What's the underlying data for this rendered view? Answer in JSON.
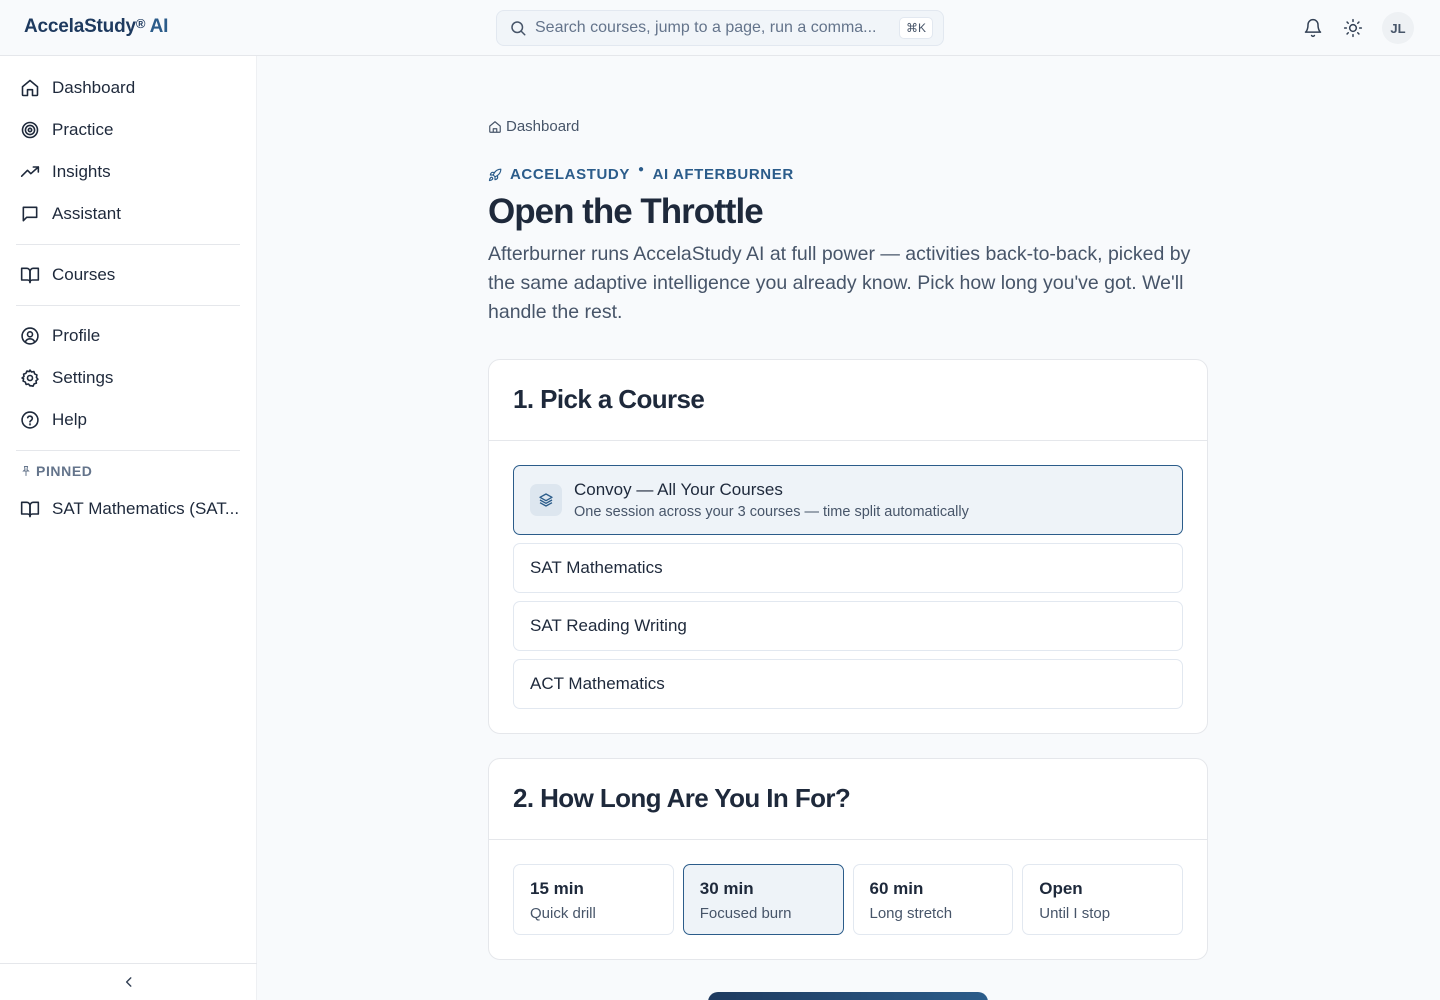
{
  "brand": {
    "name": "AccelaStudy",
    "reg": "®",
    "ai": "AI"
  },
  "search": {
    "placeholder": "Search courses, jump to a page, run a comma...",
    "shortcut": "⌘K"
  },
  "header": {
    "avatar_initials": "JL"
  },
  "sidebar": {
    "items": [
      {
        "label": "Dashboard",
        "icon": "home-icon"
      },
      {
        "label": "Practice",
        "icon": "target-icon"
      },
      {
        "label": "Insights",
        "icon": "trending-up-icon"
      },
      {
        "label": "Assistant",
        "icon": "message-square-icon"
      },
      {
        "label": "Courses",
        "icon": "book-open-icon"
      },
      {
        "label": "Profile",
        "icon": "user-circle-icon"
      },
      {
        "label": "Settings",
        "icon": "gear-icon"
      },
      {
        "label": "Help",
        "icon": "help-circle-icon"
      }
    ],
    "pinned_heading": "PINNED",
    "pinned": [
      {
        "label": "SAT Mathematics (SAT...",
        "icon": "book-open-icon"
      }
    ]
  },
  "main": {
    "breadcrumb": "Dashboard",
    "eyebrow_left": "ACCELASTUDY",
    "eyebrow_right": "AI AFTERBURNER",
    "title": "Open the Throttle",
    "description": "Afterburner runs AccelaStudy AI at full power — activities back-to-back, picked by the same adaptive intelligence you already know. Pick how long you've got. We'll handle the rest.",
    "step1": {
      "heading": "1. Pick a Course",
      "convoy": {
        "title": "Convoy — All Your Courses",
        "subtitle": "One session across your 3 courses — time split automatically"
      },
      "courses": [
        "SAT Mathematics",
        "SAT Reading Writing",
        "ACT Mathematics"
      ]
    },
    "step2": {
      "heading": "2. How Long Are You In For?",
      "durations": [
        {
          "title": "15 min",
          "sub": "Quick drill"
        },
        {
          "title": "30 min",
          "sub": "Focused burn"
        },
        {
          "title": "60 min",
          "sub": "Long stretch"
        },
        {
          "title": "Open",
          "sub": "Until I stop"
        }
      ]
    }
  },
  "colors": {
    "accent": "#2b5c8a",
    "brand": "#1e3a5f",
    "selected_bg": "#eef3f8"
  }
}
